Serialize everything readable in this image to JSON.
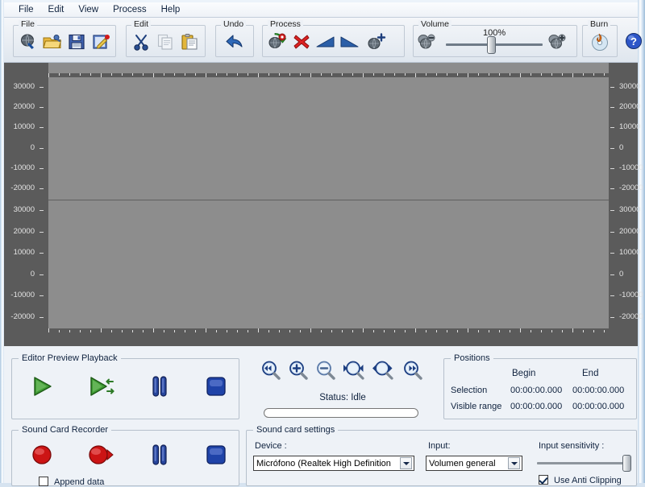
{
  "menubar": {
    "items": [
      {
        "label": "File",
        "name": "menu-file"
      },
      {
        "label": "Edit",
        "name": "menu-edit"
      },
      {
        "label": "View",
        "name": "menu-view"
      },
      {
        "label": "Process",
        "name": "menu-process"
      },
      {
        "label": "Help",
        "name": "menu-help"
      }
    ]
  },
  "toolbar": {
    "groups": {
      "file": {
        "label": "File",
        "buttons": [
          "new-icon",
          "open-folder-icon",
          "save-floppy-icon",
          "save-as-icon"
        ]
      },
      "edit": {
        "label": "Edit",
        "buttons": [
          "cut-scissors-icon",
          "copy-icon",
          "paste-clipboard-icon"
        ]
      },
      "undo": {
        "label": "Undo",
        "buttons": [
          "undo-arrow-icon"
        ]
      },
      "process": {
        "label": "Process",
        "buttons": [
          "process-refresh-icon",
          "delete-x-icon",
          "fade-in-icon",
          "fade-out-icon",
          "amplify-icon"
        ]
      },
      "volume": {
        "label": "Volume",
        "buttons": [
          "volume-down-icon",
          "volume-up-icon"
        ]
      },
      "burn": {
        "label": "Burn",
        "buttons": [
          "burn-cd-icon"
        ]
      }
    },
    "volume_value": "100%",
    "help_button": "help-icon"
  },
  "waveform": {
    "axis_labels": [
      "30000",
      "20000",
      "10000",
      "0",
      "-10000",
      "-20000"
    ],
    "channels": 2,
    "empty": true,
    "background_color": "#8d8d8d",
    "gutter_color": "#5b5b5b"
  },
  "editor_preview": {
    "label": "Editor Preview Playback",
    "buttons": [
      {
        "name": "play-button",
        "icon": "play-icon"
      },
      {
        "name": "play-loop-button",
        "icon": "play-loop-icon"
      },
      {
        "name": "pause-button",
        "icon": "pause-icon"
      },
      {
        "name": "stop-button",
        "icon": "stop-icon"
      }
    ]
  },
  "zoom_controls": {
    "buttons": [
      {
        "name": "zoom-full-out-button",
        "icon": "zoom-rewind-icon"
      },
      {
        "name": "zoom-in-button",
        "icon": "zoom-in-icon"
      },
      {
        "name": "zoom-out-button",
        "icon": "zoom-out-icon"
      },
      {
        "name": "zoom-selection-button",
        "icon": "zoom-selection-icon"
      },
      {
        "name": "zoom-fit-button",
        "icon": "zoom-fit-icon"
      },
      {
        "name": "zoom-full-in-button",
        "icon": "zoom-forward-icon"
      }
    ]
  },
  "status": {
    "text": "Status: Idle",
    "progress_percent": 0
  },
  "positions": {
    "label": "Positions",
    "col_begin": "Begin",
    "col_end": "End",
    "rows": [
      {
        "name": "Selection",
        "begin": "00:00:00.000",
        "end": "00:00:00.000"
      },
      {
        "name": "Visible range",
        "begin": "00:00:00.000",
        "end": "00:00:00.000"
      }
    ]
  },
  "recorder": {
    "label": "Sound Card Recorder",
    "buttons": [
      {
        "name": "record-button",
        "icon": "record-icon"
      },
      {
        "name": "record-play-button",
        "icon": "record-play-icon"
      },
      {
        "name": "record-pause-button",
        "icon": "pause-icon"
      },
      {
        "name": "record-stop-button",
        "icon": "stop-icon"
      }
    ],
    "append_data": {
      "label": "Append data",
      "checked": false
    }
  },
  "soundcard_settings": {
    "label": "Sound card settings",
    "device_label": "Device :",
    "device_value": "Micrófono (Realtek High Definition",
    "input_label": "Input:",
    "input_value": "Volumen general",
    "sensitivity_label": "Input sensitivity :",
    "sensitivity_percent": 100,
    "anti_clipping": {
      "label": "Use Anti Clipping",
      "checked": true
    }
  },
  "colors": {
    "window_bg": "#eef2f7",
    "toolbar_bg": "#e8edf3",
    "wave_bg": "#8d8d8d",
    "wave_gutter": "#5b5b5b",
    "accent_blue": "#1c4f9c",
    "record_red": "#cc1414",
    "play_green": "#2d8c2d"
  }
}
